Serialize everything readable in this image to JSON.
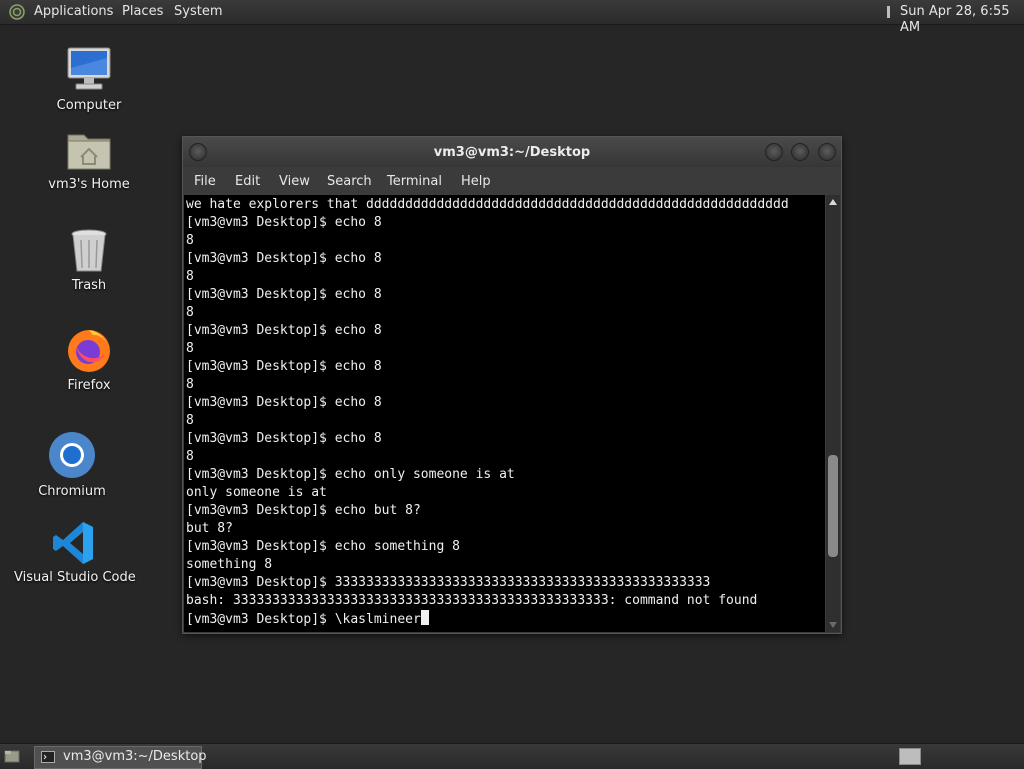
{
  "top_panel": {
    "menus": [
      "Applications",
      "Places",
      "System"
    ],
    "clock": "Sun Apr 28,  6:55 AM"
  },
  "desktop": {
    "icons": [
      {
        "label": "Computer",
        "icon": "computer-icon"
      },
      {
        "label": "vm3's Home",
        "icon": "home-folder-icon"
      },
      {
        "label": "Trash",
        "icon": "trash-icon"
      },
      {
        "label": "Firefox",
        "icon": "firefox-icon"
      },
      {
        "label": "Chromium",
        "icon": "chromium-icon"
      },
      {
        "label": "Visual Studio Code",
        "icon": "vscode-icon"
      }
    ]
  },
  "terminal": {
    "title": "vm3@vm3:~/Desktop",
    "menu": [
      "File",
      "Edit",
      "View",
      "Search",
      "Terminal",
      "Help"
    ],
    "lines": [
      "we hate explorers that dddddddddddddddddddddddddddddddddddddddddddddddddddddd",
      "[vm3@vm3 Desktop]$ echo 8",
      "8",
      "[vm3@vm3 Desktop]$ echo 8",
      "8",
      "[vm3@vm3 Desktop]$ echo 8",
      "8",
      "[vm3@vm3 Desktop]$ echo 8",
      "8",
      "[vm3@vm3 Desktop]$ echo 8",
      "8",
      "[vm3@vm3 Desktop]$ echo 8",
      "8",
      "[vm3@vm3 Desktop]$ echo 8",
      "8",
      "[vm3@vm3 Desktop]$ echo only someone is at",
      "only someone is at",
      "[vm3@vm3 Desktop]$ echo but 8?",
      "but 8?",
      "[vm3@vm3 Desktop]$ echo something 8",
      "something 8",
      "[vm3@vm3 Desktop]$ 333333333333333333333333333333333333333333333333",
      "bash: 333333333333333333333333333333333333333333333333: command not found"
    ],
    "prompt_line": "[vm3@vm3 Desktop]$ \\kaslmineer",
    "scroll_position": 0.8,
    "scroll_thumb_fraction": 0.25
  },
  "bottom_panel": {
    "task_label": "vm3@vm3:~/Desktop"
  },
  "colors": {
    "desktop_bg": "#262626",
    "terminal_bg": "#000000",
    "terminal_fg": "#f0f0f0"
  }
}
